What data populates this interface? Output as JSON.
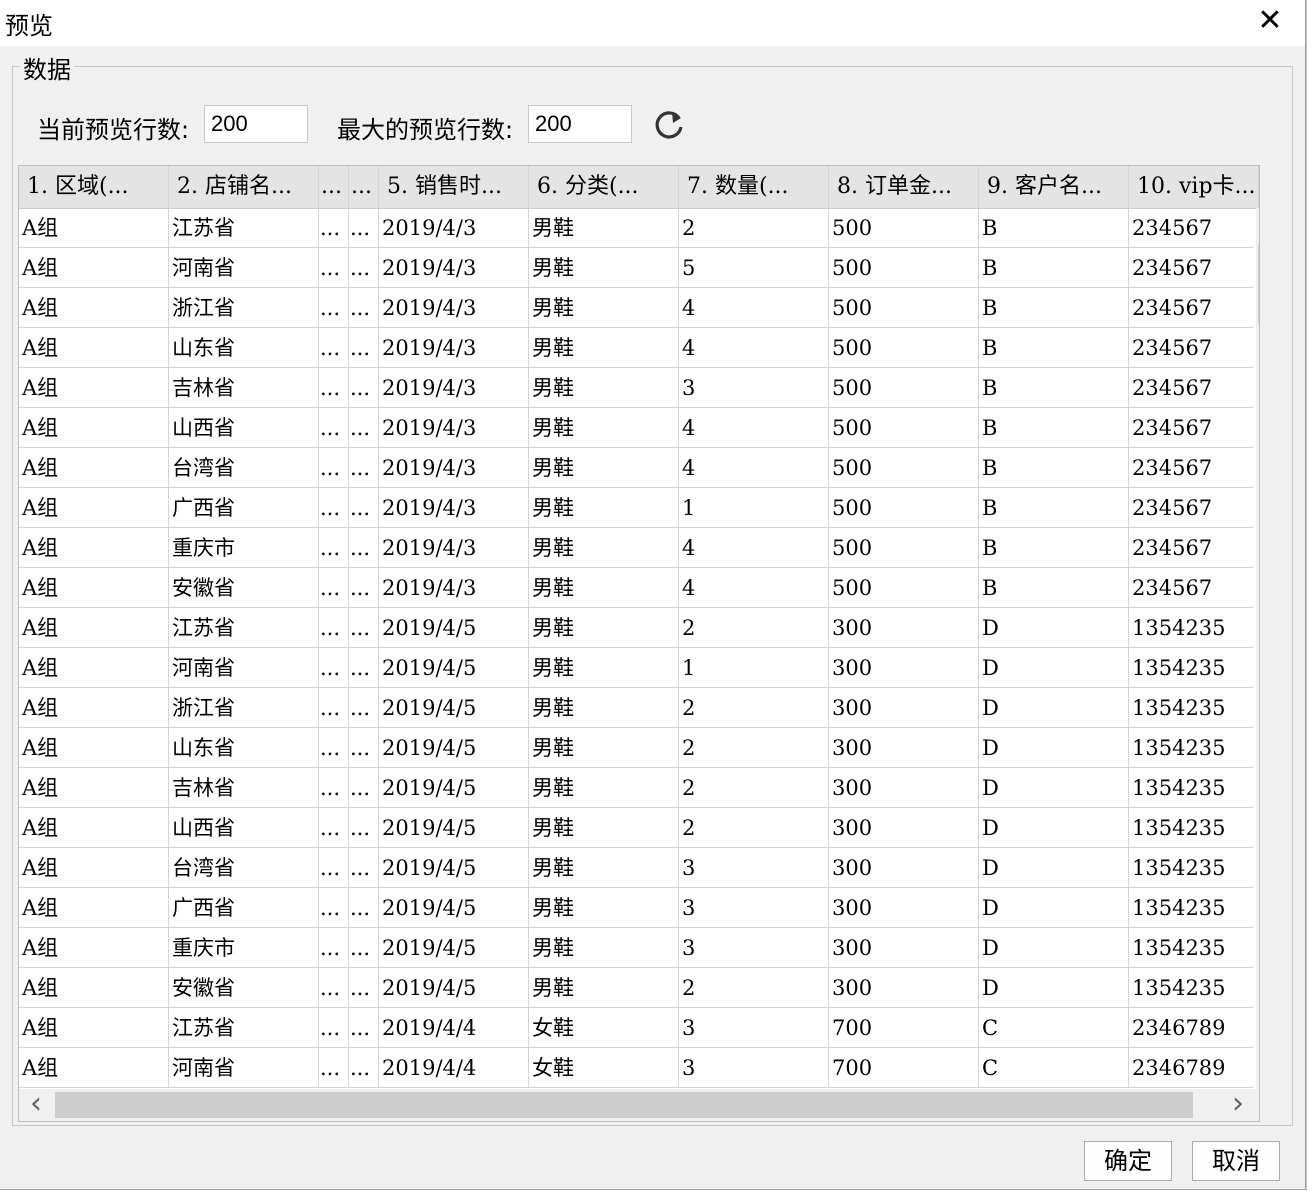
{
  "window": {
    "title": "预览",
    "close_glyph": "✕"
  },
  "group": {
    "label": "数据"
  },
  "controls": {
    "current_rows_label": "当前预览行数:",
    "current_rows_value": "200",
    "max_rows_label": "最大的预览行数:",
    "max_rows_value": "200",
    "refresh_icon": "refresh-icon"
  },
  "table": {
    "headers": [
      "1. 区域(...",
      "2. 店铺名...",
      "...",
      "...",
      "5. 销售时...",
      "6. 分类(...",
      "7. 数量(...",
      "8. 订单金...",
      "9. 客户名...",
      "10. vip卡..."
    ],
    "rows": [
      [
        "A组",
        "江苏省",
        "...",
        "...",
        "2019/4/3",
        "男鞋",
        "2",
        "500",
        "B",
        "234567"
      ],
      [
        "A组",
        "河南省",
        "...",
        "...",
        "2019/4/3",
        "男鞋",
        "5",
        "500",
        "B",
        "234567"
      ],
      [
        "A组",
        "浙江省",
        "...",
        "...",
        "2019/4/3",
        "男鞋",
        "4",
        "500",
        "B",
        "234567"
      ],
      [
        "A组",
        "山东省",
        "...",
        "...",
        "2019/4/3",
        "男鞋",
        "4",
        "500",
        "B",
        "234567"
      ],
      [
        "A组",
        "吉林省",
        "...",
        "...",
        "2019/4/3",
        "男鞋",
        "3",
        "500",
        "B",
        "234567"
      ],
      [
        "A组",
        "山西省",
        "...",
        "...",
        "2019/4/3",
        "男鞋",
        "4",
        "500",
        "B",
        "234567"
      ],
      [
        "A组",
        "台湾省",
        "...",
        "...",
        "2019/4/3",
        "男鞋",
        "4",
        "500",
        "B",
        "234567"
      ],
      [
        "A组",
        "广西省",
        "...",
        "...",
        "2019/4/3",
        "男鞋",
        "1",
        "500",
        "B",
        "234567"
      ],
      [
        "A组",
        "重庆市",
        "...",
        "...",
        "2019/4/3",
        "男鞋",
        "4",
        "500",
        "B",
        "234567"
      ],
      [
        "A组",
        "安徽省",
        "...",
        "...",
        "2019/4/3",
        "男鞋",
        "4",
        "500",
        "B",
        "234567"
      ],
      [
        "A组",
        "江苏省",
        "...",
        "...",
        "2019/4/5",
        "男鞋",
        "2",
        "300",
        "D",
        "1354235"
      ],
      [
        "A组",
        "河南省",
        "...",
        "...",
        "2019/4/5",
        "男鞋",
        "1",
        "300",
        "D",
        "1354235"
      ],
      [
        "A组",
        "浙江省",
        "...",
        "...",
        "2019/4/5",
        "男鞋",
        "2",
        "300",
        "D",
        "1354235"
      ],
      [
        "A组",
        "山东省",
        "...",
        "...",
        "2019/4/5",
        "男鞋",
        "2",
        "300",
        "D",
        "1354235"
      ],
      [
        "A组",
        "吉林省",
        "...",
        "...",
        "2019/4/5",
        "男鞋",
        "2",
        "300",
        "D",
        "1354235"
      ],
      [
        "A组",
        "山西省",
        "...",
        "...",
        "2019/4/5",
        "男鞋",
        "2",
        "300",
        "D",
        "1354235"
      ],
      [
        "A组",
        "台湾省",
        "...",
        "...",
        "2019/4/5",
        "男鞋",
        "3",
        "300",
        "D",
        "1354235"
      ],
      [
        "A组",
        "广西省",
        "...",
        "...",
        "2019/4/5",
        "男鞋",
        "3",
        "300",
        "D",
        "1354235"
      ],
      [
        "A组",
        "重庆市",
        "...",
        "...",
        "2019/4/5",
        "男鞋",
        "3",
        "300",
        "D",
        "1354235"
      ],
      [
        "A组",
        "安徽省",
        "...",
        "...",
        "2019/4/5",
        "男鞋",
        "2",
        "300",
        "D",
        "1354235"
      ],
      [
        "A组",
        "江苏省",
        "...",
        "...",
        "2019/4/4",
        "女鞋",
        "3",
        "700",
        "C",
        "2346789"
      ],
      [
        "A组",
        "河南省",
        "...",
        "...",
        "2019/4/4",
        "女鞋",
        "3",
        "700",
        "C",
        "2346789"
      ]
    ]
  },
  "scroll": {
    "up": "⌃",
    "down": "⌄",
    "left": "‹",
    "right": "›"
  },
  "buttons": {
    "ok": "确定",
    "cancel": "取消"
  }
}
